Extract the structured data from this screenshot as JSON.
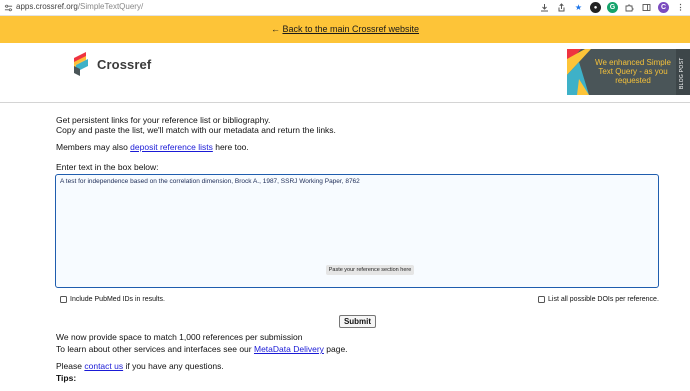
{
  "browser": {
    "url_host": "apps.crossref.org",
    "url_path": "/SimpleTextQuery/",
    "profile_initial": "C"
  },
  "banner": {
    "back_arrow": "←",
    "back_link": "Back to the main Crossref website",
    "background_color": "#fdc438"
  },
  "header": {
    "logo_text": "Crossref",
    "promo": {
      "text": "We enhanced Simple Text Query - as you requested",
      "tag": "BLOG POST"
    }
  },
  "intro": {
    "line1": "Get persistent links for your reference list or bibliography.",
    "line2": "Copy and paste the list, we'll match with our metadata and return the links.",
    "members_prefix": "Members may also ",
    "members_link": "deposit reference lists",
    "members_suffix": " here too."
  },
  "form": {
    "label": "Enter text in the box below:",
    "textarea_value": "A test for independence based on the correlation dimension, Brock A., 1987, SSRJ Working Paper, 8762",
    "textarea_hint": "Paste your reference section here",
    "include_pubmed": "Include PubMed IDs in results.",
    "list_all_dois": "List all possible DOIs per reference.",
    "submit_label": "Submit"
  },
  "footer": {
    "capacity": "We now provide space to match 1,000 references per submission",
    "services_prefix": "To learn about other services and interfaces see our ",
    "services_link": "MetaData Delivery",
    "services_suffix": " page.",
    "contact_prefix": "Please ",
    "contact_link": "contact us",
    "contact_suffix": " if you have any questions.",
    "tips": "Tips:"
  }
}
